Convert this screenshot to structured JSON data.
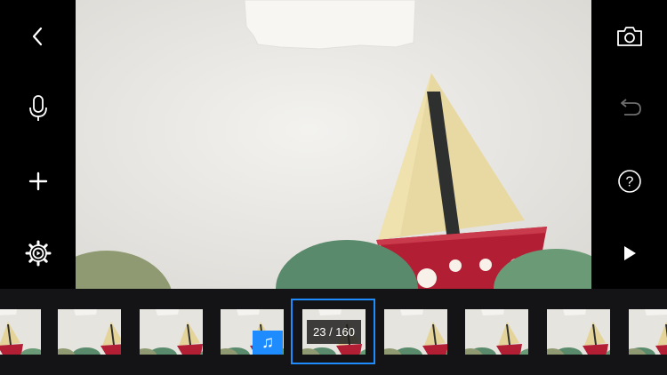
{
  "sidebar_left": {
    "buttons": [
      "back-icon",
      "microphone-icon",
      "add-icon",
      "settings-icon"
    ]
  },
  "sidebar_right": {
    "buttons": [
      "camera-icon",
      "undo-icon",
      "help-icon",
      "play-icon"
    ],
    "help_glyph": "?"
  },
  "timeline": {
    "frame_counter": "23 / 160",
    "music_glyph": "♫"
  },
  "colors": {
    "accent": "#1e8cff",
    "background": "#000000",
    "strip": "#141416"
  }
}
